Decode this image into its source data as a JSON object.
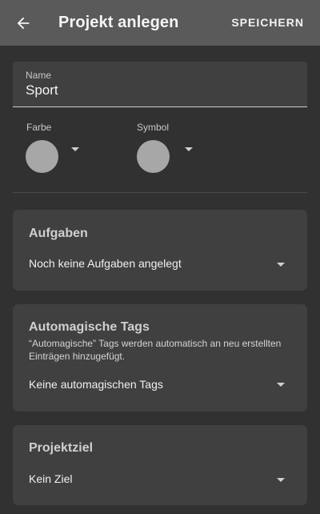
{
  "appbar": {
    "title": "Projekt anlegen",
    "save_label": "SPEICHERN",
    "back_icon": "arrow-left-icon"
  },
  "name_field": {
    "label": "Name",
    "value": "Sport"
  },
  "color_picker": {
    "label": "Farbe",
    "swatch_color": "#a7a7a7"
  },
  "symbol_picker": {
    "label": "Symbol",
    "swatch_color": "#a7a7a7"
  },
  "cards": {
    "tasks": {
      "title": "Aufgaben",
      "value": "Noch keine Aufgaben angelegt"
    },
    "tags": {
      "title": "Automagische Tags",
      "description": "“Automagische” Tags werden automatisch an neu erstellten Einträgen hinzugefügt.",
      "value": "Keine automagischen Tags"
    },
    "goal": {
      "title": "Projektziel",
      "value": "Kein Ziel"
    }
  },
  "colors": {
    "appbar": "#5a5a5a",
    "background": "#313131",
    "card": "#404040"
  }
}
